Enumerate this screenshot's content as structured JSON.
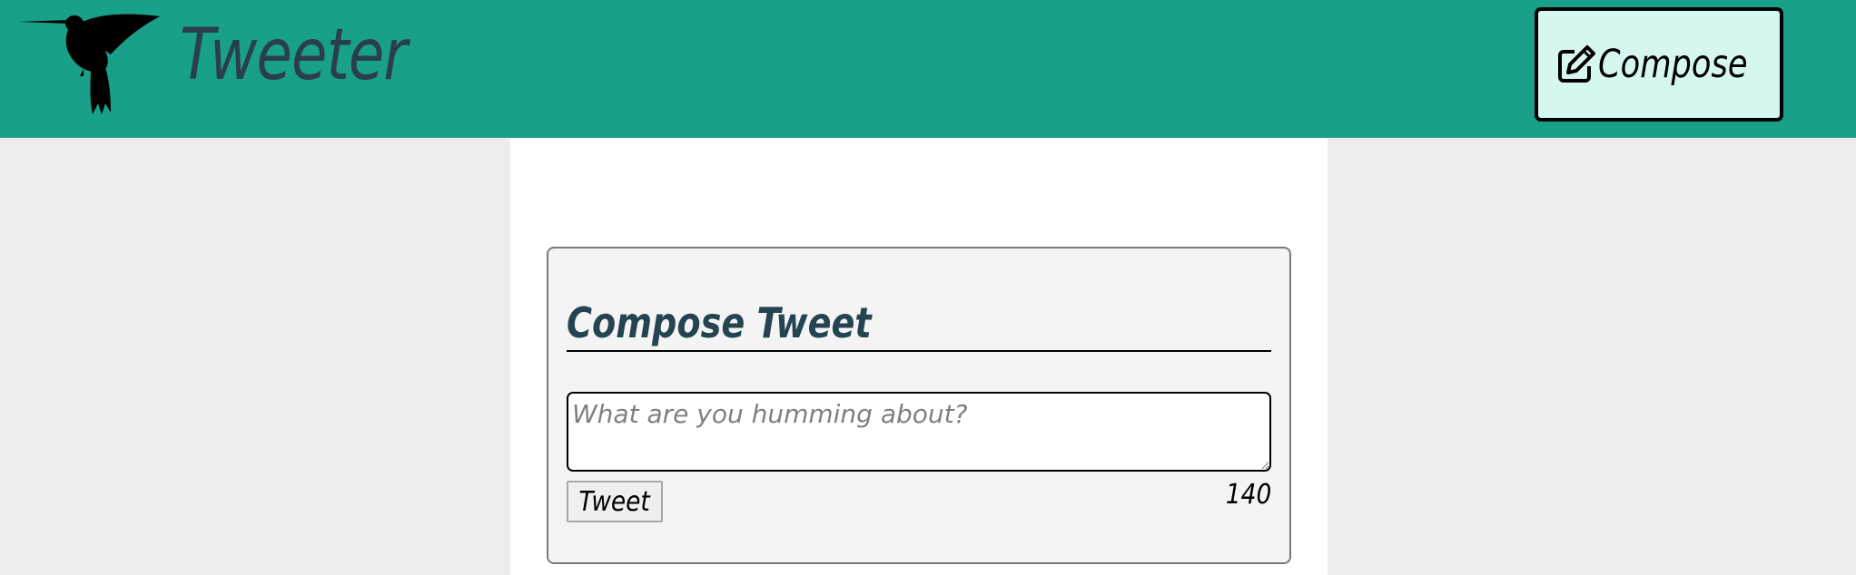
{
  "header": {
    "brand_name": "Tweeter",
    "logo_icon": "hummingbird-icon",
    "background_color": "#18a088",
    "compose_button": {
      "icon": "edit-icon",
      "label": "Compose",
      "background_color": "#d6f6f0"
    }
  },
  "compose_form": {
    "heading": "Compose Tweet",
    "textarea": {
      "value": "",
      "placeholder": "What are you humming about?"
    },
    "submit_label": "Tweet",
    "char_counter": "140"
  },
  "colors": {
    "page_background": "#ededed",
    "main_background": "#ffffff",
    "panel_background": "#f4f4f4",
    "heading_color": "#244451"
  }
}
